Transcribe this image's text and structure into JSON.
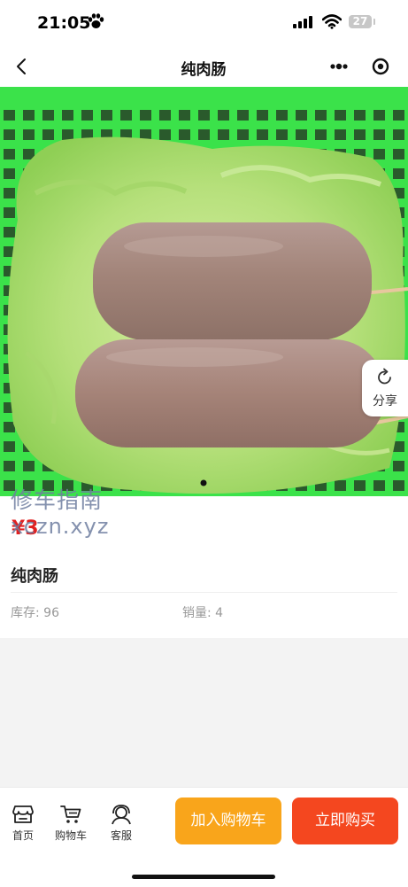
{
  "status_bar": {
    "time": "21:05",
    "battery": "27"
  },
  "nav": {
    "title": "纯肉肠"
  },
  "share": {
    "label": "分享"
  },
  "watermark": {
    "line1": "修车指南",
    "line2": "xczn.xyz"
  },
  "product": {
    "price": "¥3",
    "name": "纯肉肠",
    "stock_label": "库存: 96",
    "sales_label": "销量: 4",
    "carousel": {
      "active_index": 0,
      "total": 1
    }
  },
  "bottom_bar": {
    "tabs": [
      {
        "label": "首页",
        "icon": "shop-icon"
      },
      {
        "label": "购物车",
        "icon": "cart-icon"
      },
      {
        "label": "客服",
        "icon": "customer-service-icon"
      }
    ],
    "add_to_cart_label": "加入购物车",
    "buy_now_label": "立即购买"
  },
  "colors": {
    "price": "#e02020",
    "add_to_cart": "#f9a51b",
    "buy_now": "#f4471f"
  }
}
